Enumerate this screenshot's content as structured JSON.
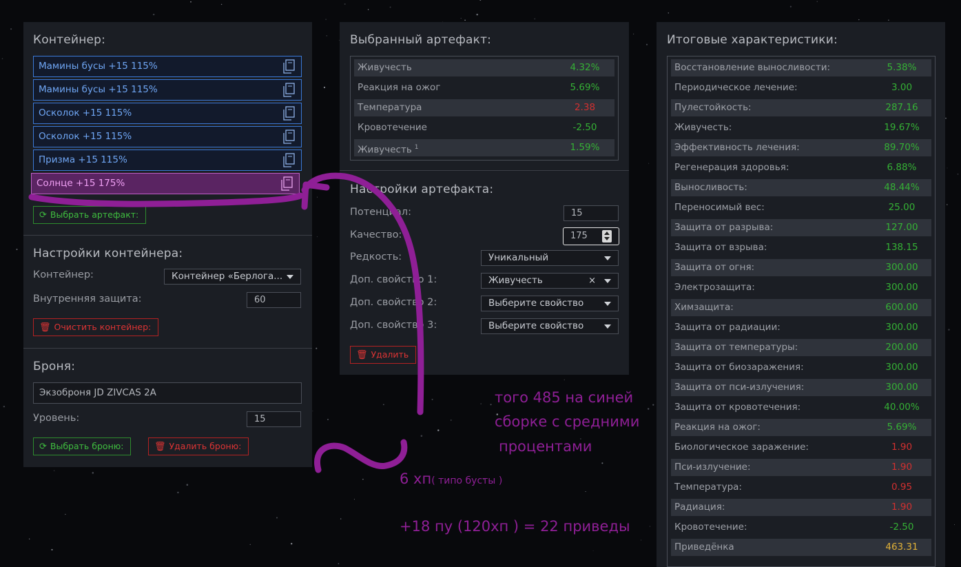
{
  "container_panel": {
    "title": "Контейнер:",
    "artifacts": [
      {
        "label": "Мамины бусы +15 115%"
      },
      {
        "label": "Мамины бусы +15 115%"
      },
      {
        "label": "Осколок +15 115%"
      },
      {
        "label": "Осколок +15 115%"
      },
      {
        "label": "Призма +15 115%"
      },
      {
        "label": "Солнце +15 175%"
      }
    ],
    "select_artifact_button": "Выбрать артефакт:",
    "settings_title": "Настройки контейнера:",
    "container_label": "Контейнер:",
    "container_value": "Контейнер «Берлога...",
    "inner_protection_label": "Внутренняя защита:",
    "inner_protection_value": "60",
    "clear_button": "Очистить контейнер:",
    "armor_title": "Броня:",
    "armor_value": "Экзоброня JD ZIVCAS 2A",
    "level_label": "Уровень:",
    "level_value": "15",
    "select_armor_button": "Выбрать броню:",
    "delete_armor_button": "Удалить броню:"
  },
  "artifact_panel": {
    "title": "Выбранный артефакт:",
    "stats": [
      {
        "name": "Живучесть",
        "value": "4.32%",
        "color": "#35b135"
      },
      {
        "name": "Реакция на ожог",
        "value": "5.69%",
        "color": "#35b135"
      },
      {
        "name": "Температура",
        "value": "2.38",
        "color": "#d23030"
      },
      {
        "name": "Кровотечение",
        "value": "-2.50",
        "color": "#35b135"
      },
      {
        "name": "Живучесть",
        "sup": "1",
        "value": "1.59%",
        "color": "#35b135"
      }
    ],
    "settings_title": "Настройки артефакта:",
    "potential_label": "Потенциал:",
    "potential_value": "15",
    "quality_label": "Качество:",
    "quality_value": "175",
    "rarity_label": "Редкость:",
    "rarity_value": "Уникальный",
    "extra1_label": "Доп. свойство 1:",
    "extra1_value": "Живучесть",
    "extra2_label": "Доп. свойство 2:",
    "extra2_value": "Выберите свойство",
    "extra3_label": "Доп. свойство 3:",
    "extra3_value": "Выберите свойство",
    "delete_button": "Удалить"
  },
  "totals_panel": {
    "title": "Итоговые характеристики:",
    "stats": [
      {
        "name": "Восстановление выносливости:",
        "value": "5.38%",
        "color": "#35b135"
      },
      {
        "name": "Периодическое лечение:",
        "value": "3.00",
        "color": "#35b135"
      },
      {
        "name": "Пулестойкость:",
        "value": "287.16",
        "color": "#35b135"
      },
      {
        "name": "Живучесть:",
        "value": "19.67%",
        "color": "#35b135"
      },
      {
        "name": "Эффективность лечения:",
        "value": "89.70%",
        "color": "#35b135"
      },
      {
        "name": "Регенерация здоровья:",
        "value": "6.88%",
        "color": "#35b135"
      },
      {
        "name": "Выносливость:",
        "value": "48.44%",
        "color": "#35b135"
      },
      {
        "name": "Переносимый вес:",
        "value": "25.00",
        "color": "#35b135"
      },
      {
        "name": "Защита от разрыва:",
        "value": "127.00",
        "color": "#35b135"
      },
      {
        "name": "Защита от взрыва:",
        "value": "138.15",
        "color": "#35b135"
      },
      {
        "name": "Защита от огня:",
        "value": "300.00",
        "color": "#35b135"
      },
      {
        "name": "Электрозащита:",
        "value": "300.00",
        "color": "#35b135"
      },
      {
        "name": "Химзащита:",
        "value": "600.00",
        "color": "#35b135"
      },
      {
        "name": "Защита от радиации:",
        "value": "300.00",
        "color": "#35b135"
      },
      {
        "name": "Защита от температуры:",
        "value": "200.00",
        "color": "#35b135"
      },
      {
        "name": "Защита от биозаражения:",
        "value": "300.00",
        "color": "#35b135"
      },
      {
        "name": "Защита от пси-излучения:",
        "value": "300.00",
        "color": "#35b135"
      },
      {
        "name": "Защита от кровотечения:",
        "value": "40.00%",
        "color": "#35b135"
      },
      {
        "name": "Реакция на ожог:",
        "value": "5.69%",
        "color": "#35b135"
      },
      {
        "name": "Биологическое заражение:",
        "value": "1.90",
        "color": "#d23030"
      },
      {
        "name": "Пси-излучение:",
        "value": "1.90",
        "color": "#d23030"
      },
      {
        "name": "Температура:",
        "value": "0.95",
        "color": "#d23030"
      },
      {
        "name": "Радиация:",
        "value": "1.90",
        "color": "#d23030"
      },
      {
        "name": "Кровотечение:",
        "value": "-2.50",
        "color": "#35b135"
      },
      {
        "name": "Приведёнка",
        "value": "463.31",
        "color": "#e2b238"
      }
    ]
  },
  "annotations": {
    "note_line1": "того 485 на синей",
    "note_line2": "сборке с средними",
    "note_line3": "процентами",
    "hp_big": "6 хп",
    "hp_small": "( типо бусты )",
    "bottom_note": "+18 пу (120хп ) = 22 приведы",
    "ink_color": "#8f1f96"
  }
}
